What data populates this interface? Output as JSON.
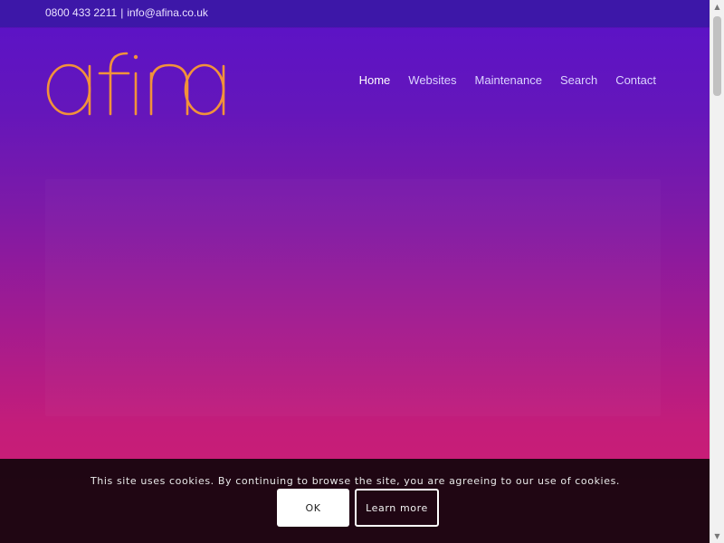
{
  "topbar": {
    "phone": "0800 433 2211",
    "separator": "|",
    "email": "info@afina.co.uk"
  },
  "logo": {
    "text": "afina",
    "color": "#f2923a"
  },
  "nav": {
    "items": [
      {
        "label": "Home",
        "active": true
      },
      {
        "label": "Websites",
        "active": false
      },
      {
        "label": "Maintenance",
        "active": false
      },
      {
        "label": "Search",
        "active": false
      },
      {
        "label": "Contact",
        "active": false
      }
    ]
  },
  "cookie": {
    "message": "This site uses cookies. By continuing to browse the site, you are agreeing to our use of cookies.",
    "ok_label": "OK",
    "learn_more_label": "Learn more"
  },
  "colors": {
    "topbar": "#3d17a8",
    "gradient_top": "#5a12c9",
    "gradient_bottom": "#d21d70",
    "cookie_bar": "#12040c"
  }
}
